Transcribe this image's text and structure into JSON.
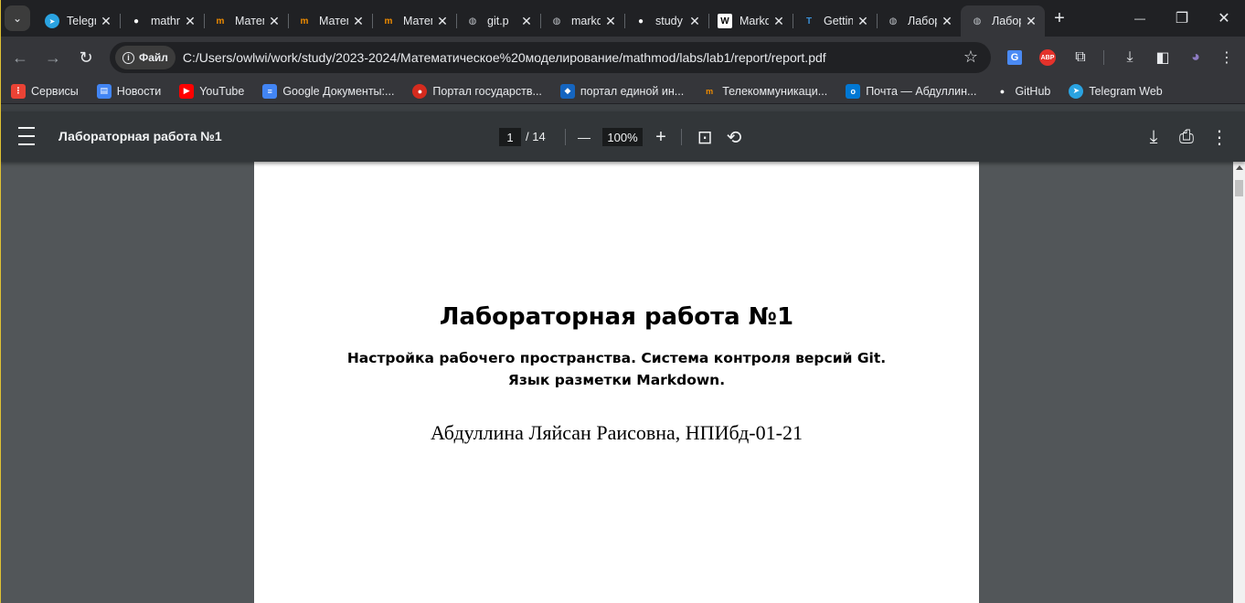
{
  "tabs": [
    {
      "title": "Telegram Web",
      "icon": "telegram-icon",
      "color": "#2aa3e1",
      "glyph": "➤"
    },
    {
      "title": "mathmod",
      "icon": "github-icon",
      "color": "#ffffff",
      "glyph": "●"
    },
    {
      "title": "Математическое",
      "icon": "mirea-icon",
      "color": "#f08c00",
      "glyph": "m"
    },
    {
      "title": "Математическое",
      "icon": "mirea-icon",
      "color": "#f08c00",
      "glyph": "m"
    },
    {
      "title": "Математическое",
      "icon": "mirea-icon",
      "color": "#f08c00",
      "glyph": "m"
    },
    {
      "title": "git.p",
      "icon": "globe-icon",
      "color": "#bdc1c6",
      "glyph": "◍"
    },
    {
      "title": "markdown",
      "icon": "globe-icon",
      "color": "#bdc1c6",
      "glyph": "◍"
    },
    {
      "title": "study",
      "icon": "github-icon",
      "color": "#ffffff",
      "glyph": "●"
    },
    {
      "title": "Markdown",
      "icon": "wikipedia-icon",
      "color": "#ffffff",
      "glyph": "W"
    },
    {
      "title": "Getting",
      "icon": "tex-icon",
      "color": "#3a8fd6",
      "glyph": "T"
    },
    {
      "title": "Лабораторная",
      "icon": "globe-icon",
      "color": "#bdc1c6",
      "glyph": "◍"
    },
    {
      "title": "Лабораторная",
      "icon": "globe-icon",
      "color": "#bdc1c6",
      "glyph": "◍",
      "active": true
    }
  ],
  "tab_close_glyph": "✕",
  "new_tab_glyph": "+",
  "window": {
    "minimize": "—",
    "restore": "❐",
    "close": "✕"
  },
  "nav": {
    "back": "←",
    "forward": "→",
    "reload": "↻"
  },
  "omnibox": {
    "chip_label": "Файл",
    "url": "C:/Users/owlwi/work/study/2023-2024/Математическое%20моделирование/mathmod/labs/lab1/report/report.pdf",
    "star": "☆"
  },
  "extensions": [
    {
      "name": "translate-icon",
      "glyph": "G",
      "color": "#4a8af4"
    },
    {
      "name": "adblock-icon",
      "glyph": "ABP",
      "color": "#e4322b"
    },
    {
      "name": "puzzle-icon",
      "glyph": "⧉",
      "color": "#e8eaed"
    },
    {
      "name": "download-icon",
      "glyph": "⤓",
      "color": "#e8eaed"
    },
    {
      "name": "sidepanel-icon",
      "glyph": "◧",
      "color": "#e8eaed"
    },
    {
      "name": "profile-icon",
      "glyph": "◕",
      "color": "#8e7cc3"
    },
    {
      "name": "menu-icon",
      "glyph": "⋮",
      "color": "#e8eaed"
    }
  ],
  "bookmarks": [
    {
      "label": "Сервисы",
      "icon": "apps-icon",
      "color": "#ea4335",
      "glyph": "⋮"
    },
    {
      "label": "Новости",
      "icon": "news-icon",
      "color": "#4285f4",
      "glyph": "▤"
    },
    {
      "label": "YouTube",
      "icon": "youtube-icon",
      "color": "#ff0000",
      "glyph": "▶"
    },
    {
      "label": "Google Документы:...",
      "icon": "docs-icon",
      "color": "#4285f4",
      "glyph": "≡"
    },
    {
      "label": "Портал государств...",
      "icon": "gosuslugi-icon",
      "color": "#d52b1e",
      "glyph": "●"
    },
    {
      "label": "портал единой ин...",
      "icon": "portal-icon",
      "color": "#1565c0",
      "glyph": "◆"
    },
    {
      "label": "Телекоммуникаци...",
      "icon": "mirea-icon",
      "color": "#f08c00",
      "glyph": "m"
    },
    {
      "label": "Почта — Абдуллин...",
      "icon": "outlook-icon",
      "color": "#0078d4",
      "glyph": "o"
    },
    {
      "label": "GitHub",
      "icon": "github-icon",
      "color": "#ffffff",
      "glyph": "●"
    },
    {
      "label": "Telegram Web",
      "icon": "telegram-icon",
      "color": "#2aa3e1",
      "glyph": "➤"
    }
  ],
  "pdf": {
    "title": "Лабораторная работа №1",
    "page_current": "1",
    "page_total": "/ 14",
    "zoom": "100%",
    "zoom_out": "—",
    "zoom_in": "+",
    "fit_glyph": "⊡",
    "rotate_glyph": "⟲",
    "download_glyph": "⤓",
    "print_glyph": "⎙",
    "more_glyph": "⋮"
  },
  "document": {
    "title": "Лабораторная работа №1",
    "subtitle_line1": "Настройка рабочего пространства. Система контроля версий Git.",
    "subtitle_line2": "Язык разметки Markdown.",
    "author": "Абдуллина Ляйсан Раисовна, НПИбд-01-21"
  }
}
